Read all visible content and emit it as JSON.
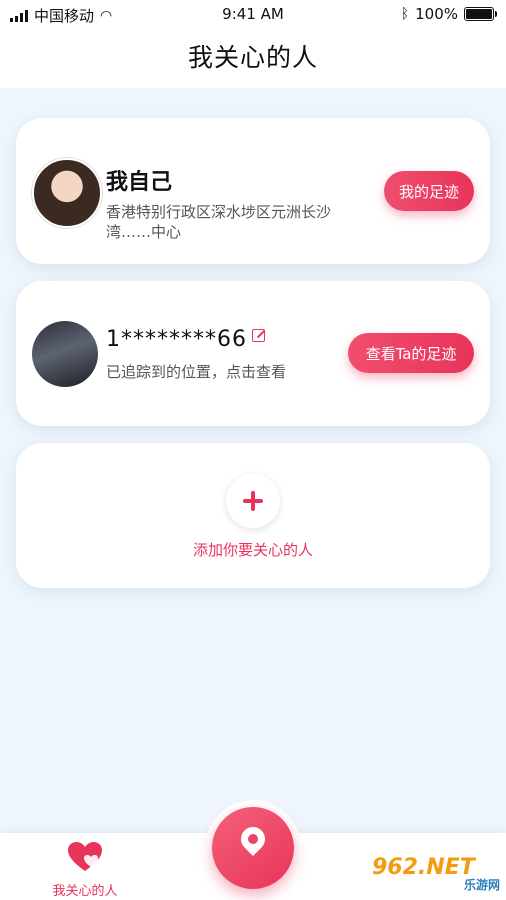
{
  "status_bar": {
    "carrier": "中国移动",
    "time": "9:41 AM",
    "battery": "100%"
  },
  "header": {
    "title": "我关心的人"
  },
  "self_card": {
    "name": "我自己",
    "address": "香港特别行政区深水埗区元洲长沙湾……中心",
    "button_label": "我的足迹"
  },
  "contact_card": {
    "phone_visible": "1********66",
    "status_text": "已追踪到的位置，点击查看",
    "button_label": "查看Ta的足迹"
  },
  "add_card": {
    "label": "添加你要关心的人"
  },
  "tabbar": {
    "left_tab_label": "我关心的人"
  },
  "watermark": {
    "logo_text": "962.NET",
    "logo_sub": "乐游网"
  },
  "colors": {
    "accent": "#e8345a",
    "background": "#eef5fc"
  }
}
